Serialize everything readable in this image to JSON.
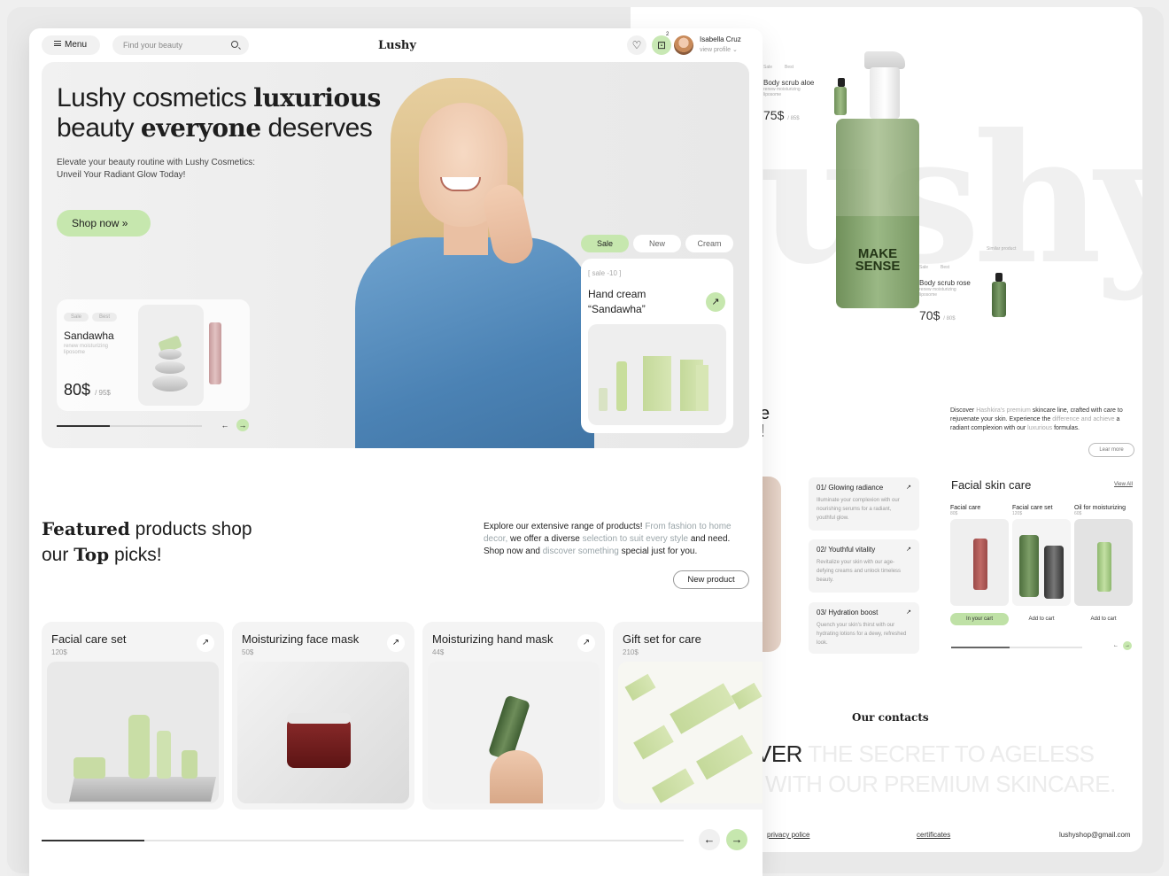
{
  "header": {
    "menu_label": "Menu",
    "search_placeholder": "Find your beauty",
    "logo": "Lushy",
    "cart_count": "2",
    "user_name": "Isabella Cruz",
    "user_sub": "view profile"
  },
  "hero": {
    "title_part1": "Lushy cosmetics ",
    "title_bold1": "luxurious",
    "title_part2": "beauty ",
    "title_bold2": "everyone",
    "title_part3": " deserves",
    "subtitle": "Elevate your beauty routine with Lushy Cosmetics: Unveil Your Radiant Glow Today!",
    "cta": "Shop now",
    "tabs": [
      "Sale",
      "New",
      "Cream"
    ],
    "product_card": {
      "tags": [
        "Sale",
        "Best"
      ],
      "name": "Sandawha",
      "desc": "renew moisturizing liposome",
      "price": "80$",
      "old_price": "/ 95$"
    },
    "sale_card": {
      "sale": "[ sale -10 ]",
      "title_line1": "Hand cream",
      "title_line2": "“Sandawha”"
    }
  },
  "featured": {
    "title_bold1": "Featured",
    "title_rest1": " products shop",
    "title_pre2": "our ",
    "title_bold2": "Top",
    "title_rest2": " picks!",
    "desc_1": "Explore our extensive range of products! ",
    "desc_2": "From fashion to home decor,",
    "desc_3": " we offer a diverse ",
    "desc_4": "selection to suit every style",
    "desc_5": " and need. Shop now and ",
    "desc_6": "discover something",
    "desc_7": " special just for you.",
    "new_product_btn": "New product",
    "products": [
      {
        "name": "Facial care set",
        "price": "120$"
      },
      {
        "name": "Moisturizing face mask",
        "price": "50$"
      },
      {
        "name": "Moisturizing hand mask",
        "price": "44$"
      },
      {
        "name": "Gift set for care",
        "price": "210$"
      }
    ]
  },
  "right_page": {
    "watermark": "ushy",
    "bottle_label": "MAKE SENSE",
    "mini_a": {
      "tags": [
        "Sale",
        "Best"
      ],
      "name": "Body scrub aloe",
      "desc": "renew moisturizing liposome",
      "price": "75$",
      "old": "/ 85$"
    },
    "mini_b": {
      "tags": [
        "Sale",
        "Best"
      ],
      "name": "Body scrub rose",
      "desc": "renew moisturizing liposome",
      "price": "70$",
      "old": "/ 80$",
      "similar": "Similar product"
    },
    "discover_1": "Discover ",
    "discover_2": "Hashkira's premium",
    "discover_3": " skincare line, crafted with care to rejuvenate your skin. Experience the ",
    "discover_4": "difference and achieve",
    "discover_5": " a radiant complexion with our ",
    "discover_6": "luxurious",
    "discover_7": " formulas.",
    "learn_more": "Lear more",
    "features": [
      {
        "title": "01/ Glowing radiance",
        "desc": "Illuminate your complexion with our nourishing serums for a radiant, youthful glow."
      },
      {
        "title": "02/ Youthful vitality",
        "desc": "Revitalize your skin with our age-defying creams and unlock timeless beauty."
      },
      {
        "title": "03/ Hydration boost",
        "desc": "Quench your skin's thirst with our hydrating lotions for a dewy, refreshed look."
      }
    ],
    "facial_title": "Facial skin care",
    "view_all": "View All",
    "facial_items": [
      {
        "label": "Facial care",
        "price": "80$",
        "button": "In your cart"
      },
      {
        "label": "Facial care set",
        "price": "120$",
        "button": "Add to cart"
      },
      {
        "label": "Oil for moisturizing",
        "price": "60$",
        "button": "Add to cart"
      }
    ],
    "contacts_title": "Our contacts",
    "slogan_dark": "VER",
    "slogan_light1": " THE SECRET TO AGELESS",
    "slogan_light2": "WITH OUR PREMIUM SKINCARE.",
    "footer": {
      "privacy": "privacy police",
      "certificates": "certificates",
      "email": "lushyshop@gmail.com"
    }
  },
  "colors": {
    "accent": "#c6e7ae",
    "text": "#1e1e1e",
    "muted": "#999999"
  }
}
